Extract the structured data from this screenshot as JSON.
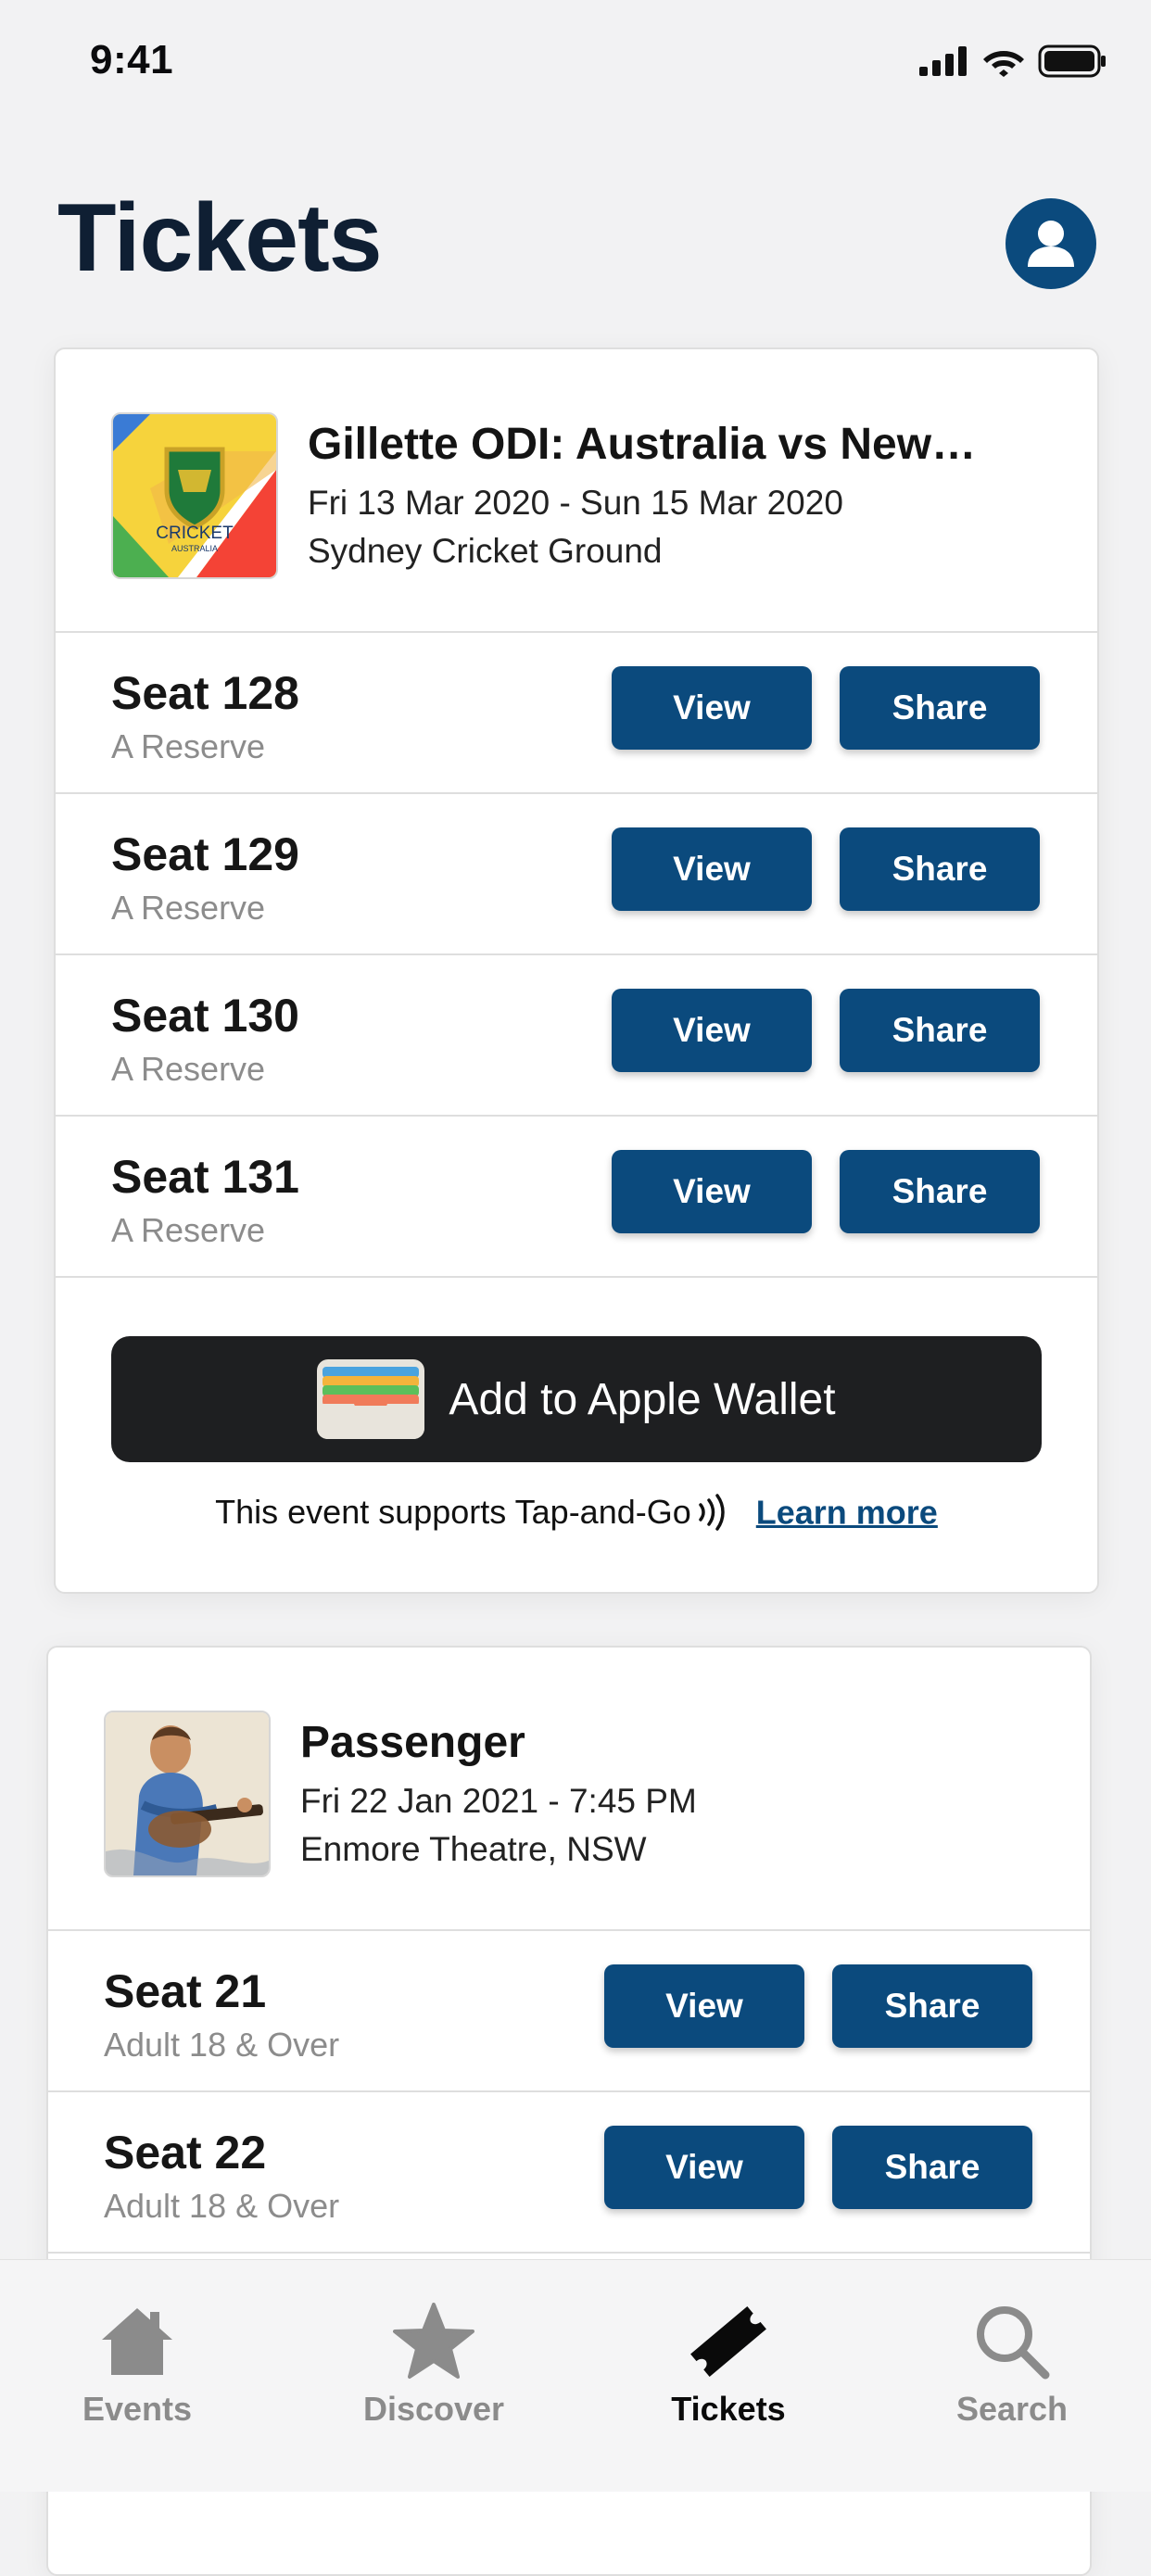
{
  "status_bar": {
    "time": "9:41"
  },
  "header": {
    "title": "Tickets"
  },
  "colors": {
    "accent": "#0b4a7d",
    "wallet_bg": "#1e1f21",
    "background": "#f2f2f3"
  },
  "events": [
    {
      "title": "Gillette ODI: Australia vs New…",
      "date": "Fri 13 Mar 2020 - Sun 15 Mar 2020",
      "venue": "Sydney Cricket Ground",
      "logo_text": "CRICKET",
      "logo_subtext": "AUSTRALIA",
      "seats": [
        {
          "label": "Seat 128",
          "type": "A Reserve",
          "view": "View",
          "share": "Share"
        },
        {
          "label": "Seat 129",
          "type": "A Reserve",
          "view": "View",
          "share": "Share"
        },
        {
          "label": "Seat 130",
          "type": "A Reserve",
          "view": "View",
          "share": "Share"
        },
        {
          "label": "Seat 131",
          "type": "A Reserve",
          "view": "View",
          "share": "Share"
        }
      ],
      "wallet_label": "Add to Apple Wallet",
      "tap_text": "This event supports Tap-and-Go",
      "learn_more": "Learn more"
    },
    {
      "title": "Passenger",
      "date": "Fri 22 Jan 2021 - 7:45 PM",
      "venue": "Enmore Theatre, NSW",
      "seats": [
        {
          "label": "Seat 21",
          "type": "Adult 18 & Over",
          "view": "View",
          "share": "Share"
        },
        {
          "label": "Seat 22",
          "type": "Adult 18 & Over",
          "view": "View",
          "share": "Share"
        }
      ]
    }
  ],
  "tab_bar": {
    "tabs": [
      {
        "label": "Events",
        "icon": "home-icon",
        "active": false
      },
      {
        "label": "Discover",
        "icon": "star-icon",
        "active": false
      },
      {
        "label": "Tickets",
        "icon": "ticket-icon",
        "active": true
      },
      {
        "label": "Search",
        "icon": "search-icon",
        "active": false
      }
    ]
  }
}
